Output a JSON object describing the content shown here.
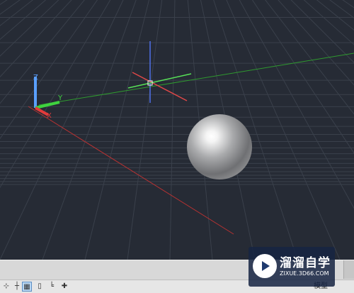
{
  "viewport": {
    "background": "#262b35",
    "ucs_labels": {
      "z": "Z",
      "y": "Y",
      "x": "X"
    },
    "colors": {
      "x_axis": "#e33b3b",
      "y_axis": "#3fd23f",
      "z_axis": "#4f6fe8",
      "ucs_z": "#5aa0ff"
    },
    "sphere": {
      "shading": "metallic grey"
    }
  },
  "command_line": {
    "text": ""
  },
  "status_bar": {
    "buttons": [
      {
        "name": "snap-button",
        "icon": "snap-icon",
        "glyph": ""
      },
      {
        "name": "grid-button",
        "icon": "grid-icon",
        "glyph": ""
      },
      {
        "name": "ortho-button",
        "icon": "ortho-icon",
        "glyph": ""
      },
      {
        "name": "osnap-button",
        "icon": "osnap-icon",
        "glyph": ""
      },
      {
        "name": "otrack-button",
        "icon": "otrack-icon",
        "glyph": ""
      },
      {
        "name": "dyn-button",
        "icon": "dyn-icon",
        "glyph": ""
      }
    ],
    "model_tab": "模型"
  },
  "watermark": {
    "title": "溜溜自学",
    "url": "ZIXUE.3D66.COM"
  }
}
